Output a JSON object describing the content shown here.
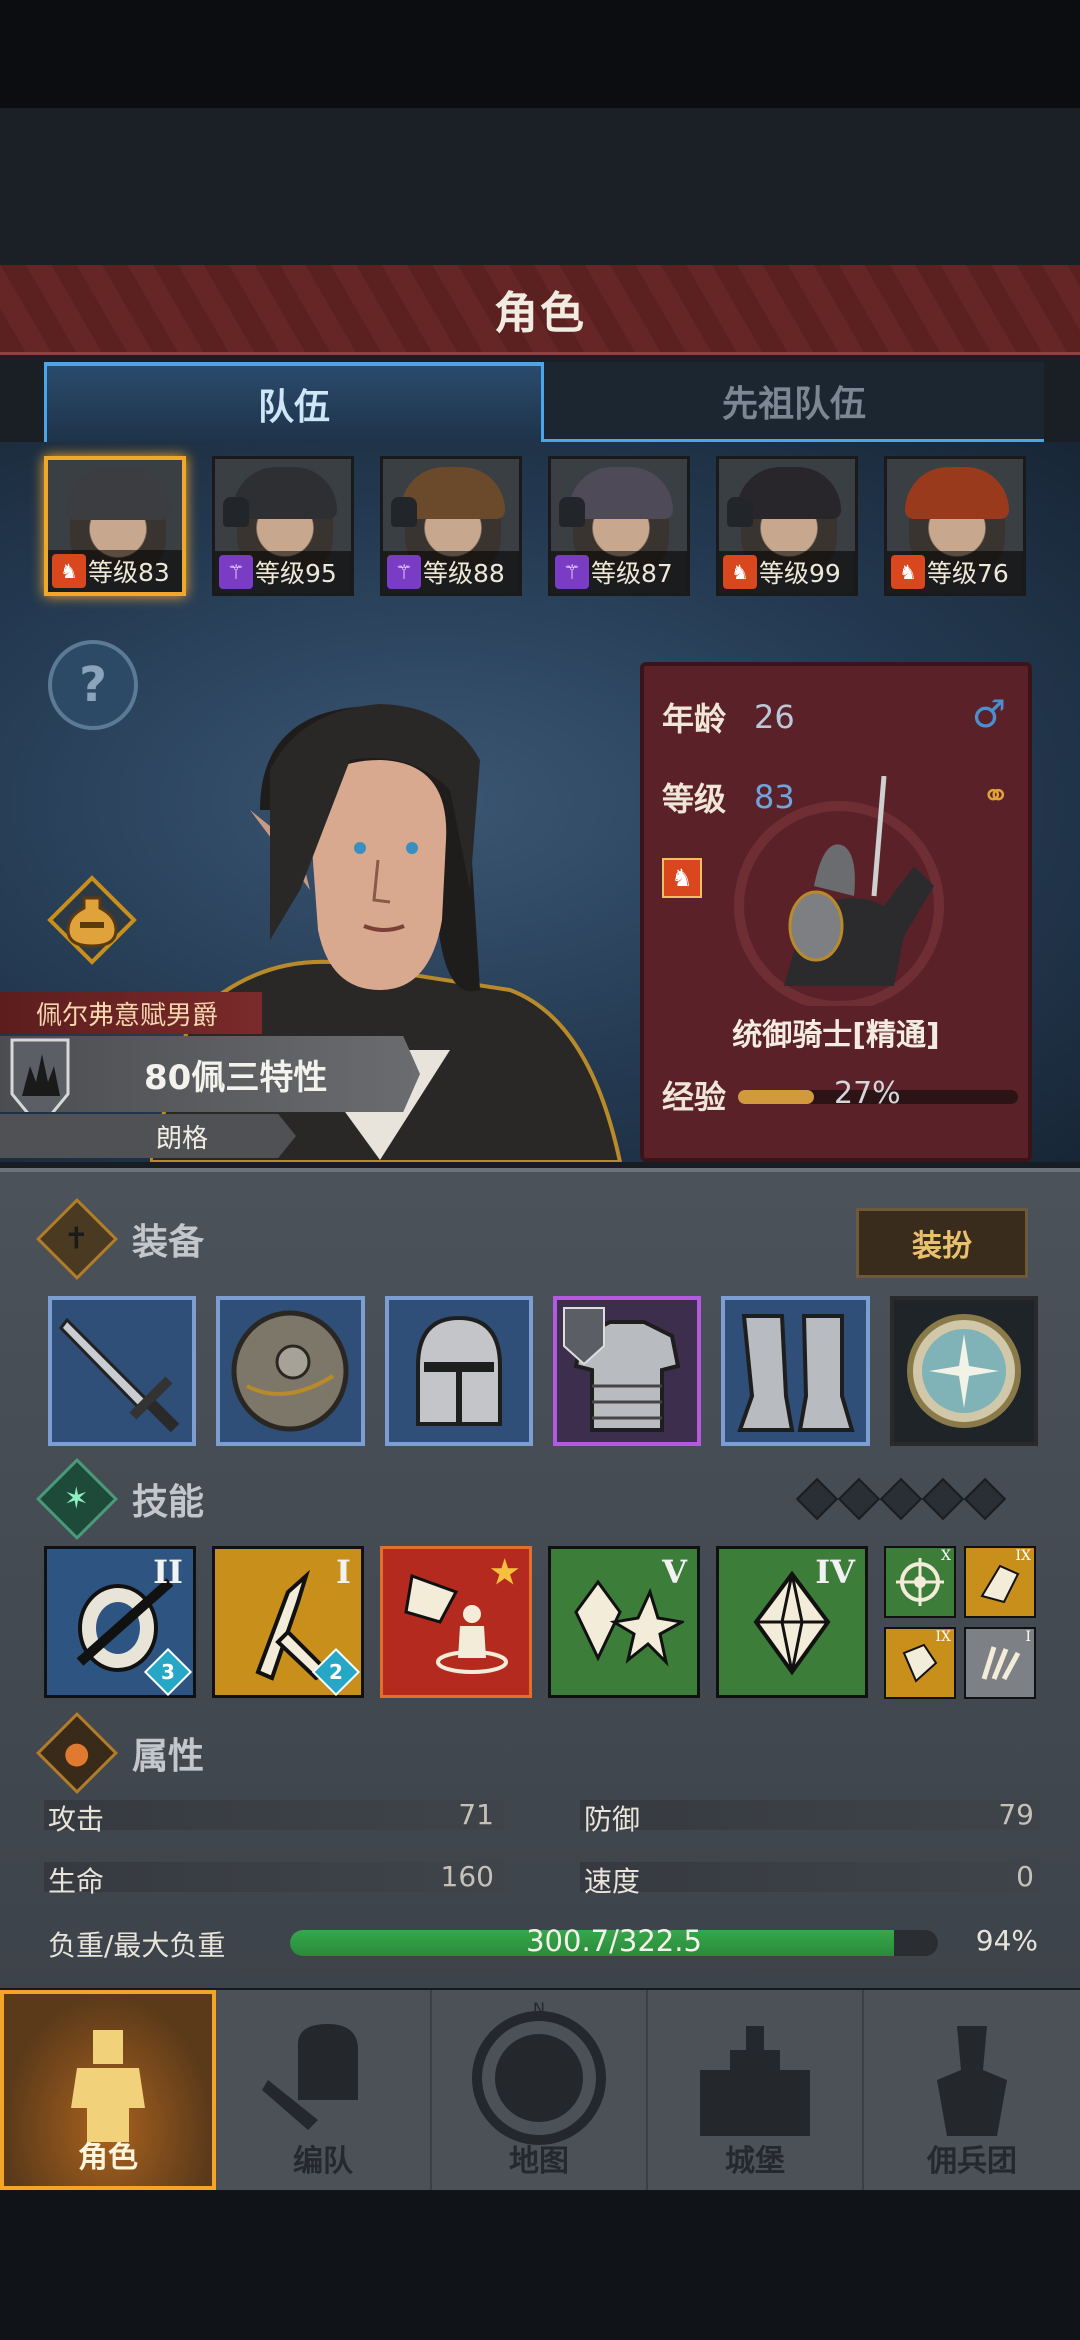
{
  "header": {
    "title": "角色"
  },
  "tabs": [
    {
      "label": "队伍"
    },
    {
      "label": "先祖队伍"
    }
  ],
  "party": [
    {
      "level_text": "等级83",
      "class_icon": "knight-icon",
      "hair": "#3b3d41",
      "selected": true
    },
    {
      "level_text": "等级95",
      "class_icon": "staff-icon",
      "hair": "#2d2f33",
      "selected": false
    },
    {
      "level_text": "等级88",
      "class_icon": "staff-icon",
      "hair": "#6a4a2a",
      "selected": false
    },
    {
      "level_text": "等级87",
      "class_icon": "staff-icon",
      "hair": "#4e4a58",
      "selected": false
    },
    {
      "level_text": "等级99",
      "class_icon": "knight-icon",
      "hair": "#28262a",
      "selected": false
    },
    {
      "level_text": "等级76",
      "class_icon": "knight-icon",
      "hair": "#9a3a1c",
      "selected": false
    }
  ],
  "character": {
    "title": "佩尔弗意赋男爵",
    "name": "80佩三特性",
    "subtitle": "朗格",
    "age_label": "年龄",
    "age": "26",
    "level_label": "等级",
    "level": "83",
    "class_name": "统御骑士[精通]",
    "exp_label": "经验",
    "exp_percent": "27%",
    "exp_fraction": 0.27
  },
  "equipment": {
    "label": "装备",
    "dress_button": "装扮",
    "items": [
      "sword-icon",
      "shield-icon",
      "helmet-icon",
      "armor-icon",
      "greaves-icon",
      "amulet-icon"
    ]
  },
  "skills": {
    "label": "技能",
    "items": [
      {
        "icon": "lance-shield-icon",
        "rank": "II",
        "badge": "3",
        "color": "blue"
      },
      {
        "icon": "sword-strike-icon",
        "rank": "I",
        "badge": "2",
        "color": "gold"
      },
      {
        "icon": "rally-icon",
        "rank": "★",
        "badge": "",
        "color": "red"
      },
      {
        "icon": "crystal-burst-icon",
        "rank": "V",
        "badge": "",
        "color": "green"
      },
      {
        "icon": "crystal-icon",
        "rank": "IV",
        "badge": "",
        "color": "green"
      }
    ],
    "passives": [
      {
        "icon": "target-icon",
        "rank": "X"
      },
      {
        "icon": "charge-icon",
        "rank": "IX"
      },
      {
        "icon": "shield-bash-icon",
        "rank": "IX"
      },
      {
        "icon": "claw-icon",
        "rank": "I"
      }
    ]
  },
  "attributes": {
    "label": "属性",
    "attack_label": "攻击",
    "attack": "71",
    "defense_label": "防御",
    "defense": "79",
    "hp_label": "生命",
    "hp": "160",
    "speed_label": "速度",
    "speed": "0",
    "load_label": "负重/最大负重",
    "load_text": "300.7/322.5",
    "load_percent": "94%",
    "load_fraction": 0.932
  },
  "nav": [
    {
      "label": "角色"
    },
    {
      "label": "编队"
    },
    {
      "label": "地图"
    },
    {
      "label": "城堡"
    },
    {
      "label": "佣兵团"
    }
  ],
  "colors": {
    "selected_border": "#f0a82c",
    "exp_bar": "#d19a3c",
    "load_bar": "#37a84a",
    "active_tab": "#4aa6e8"
  }
}
